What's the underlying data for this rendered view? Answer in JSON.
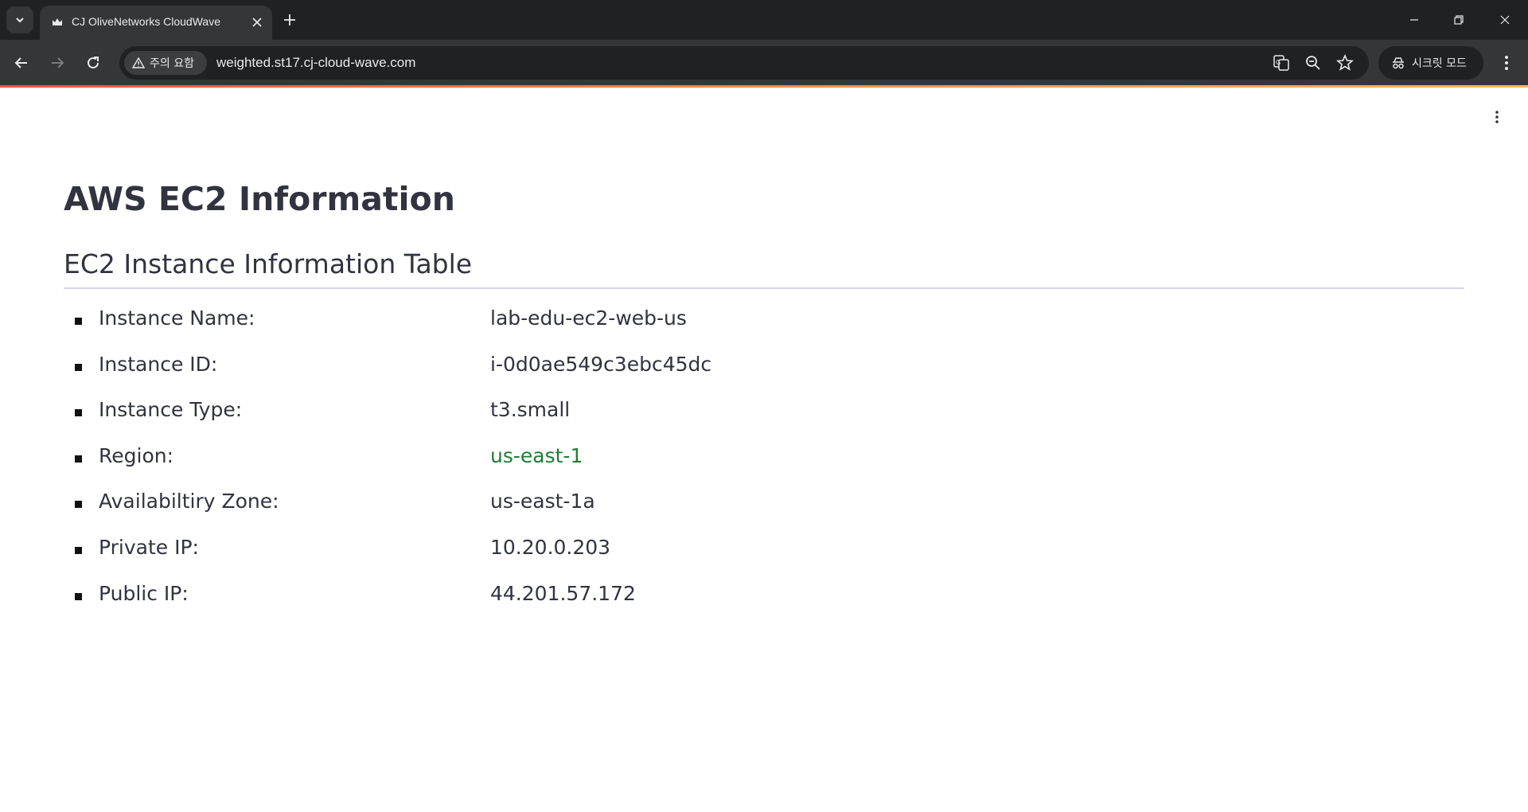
{
  "browser": {
    "tab_title": "CJ OliveNetworks CloudWave",
    "security_label": "주의 요함",
    "url": "weighted.st17.cj-cloud-wave.com",
    "incognito_label": "시크릿 모드"
  },
  "page": {
    "title": "AWS EC2 Information",
    "section_title": "EC2 Instance Information Table",
    "items": [
      {
        "label": "Instance Name:",
        "value": "lab-edu-ec2-web-us"
      },
      {
        "label": "Instance ID:",
        "value": "i-0d0ae549c3ebc45dc"
      },
      {
        "label": "Instance Type:",
        "value": "t3.small"
      },
      {
        "label": "Region:",
        "value": "us-east-1"
      },
      {
        "label": "Availabiltiry Zone:",
        "value": "us-east-1a"
      },
      {
        "label": "Private IP:",
        "value": "10.20.0.203"
      },
      {
        "label": "Public IP:",
        "value": "44.201.57.172"
      }
    ]
  },
  "colors": {
    "region_value": "#1e7f34",
    "text": "#31333f",
    "chrome_dark": "#202124",
    "chrome_toolbar": "#35363a"
  },
  "icons": [
    "tab-list-icon",
    "crown-favicon-icon",
    "close-icon",
    "plus-icon",
    "minimize-icon",
    "restore-icon",
    "window-close-icon",
    "back-arrow-icon",
    "forward-arrow-icon",
    "reload-icon",
    "warning-icon",
    "translate-icon",
    "zoom-icon",
    "star-icon",
    "incognito-icon",
    "kebab-menu-icon"
  ]
}
